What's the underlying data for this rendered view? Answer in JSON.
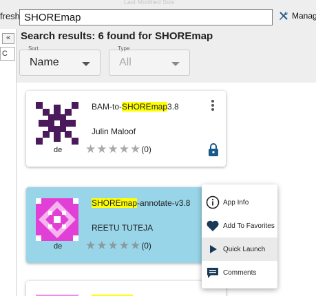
{
  "topbar": {
    "ghost_columns": "Last Modified          Size",
    "refresh_label": "fresh",
    "search_value": "SHOREmap",
    "manage_label": "Manag"
  },
  "leftbar": {
    "collapse_label": "«",
    "tab_label": "C"
  },
  "results": {
    "title": "Search results: 6 found for SHOREmap",
    "sort": {
      "label": "Sort",
      "value": "Name"
    },
    "type": {
      "label": "Type",
      "value": "All"
    }
  },
  "apps": [
    {
      "name_prefix": "BAM-to-",
      "name_match": "SHOREmap",
      "name_suffix": "3.8",
      "author": "Julin Maloof",
      "owner": "de",
      "rating_count": "(0)",
      "locked": true,
      "thumb_color": "#4a1a5c"
    },
    {
      "name_prefix": "",
      "name_match": "SHOREmap",
      "name_suffix": "-annotate-v3.8",
      "author": "REETU TUTEJA",
      "owner": "de",
      "rating_count": "(0)",
      "locked": false,
      "thumb_color": "#e23fd6"
    }
  ],
  "menu": {
    "items": [
      {
        "label": "App Info",
        "icon": "info-icon"
      },
      {
        "label": "Add To Favorites",
        "icon": "heart-icon"
      },
      {
        "label": "Quick Launch",
        "icon": "play-icon"
      },
      {
        "label": "Comments",
        "icon": "comments-icon"
      }
    ]
  },
  "colors": {
    "highlight_card": "#99d5e9",
    "search_highlight": "#ffff00",
    "accent_blue": "#1a5a8a"
  }
}
